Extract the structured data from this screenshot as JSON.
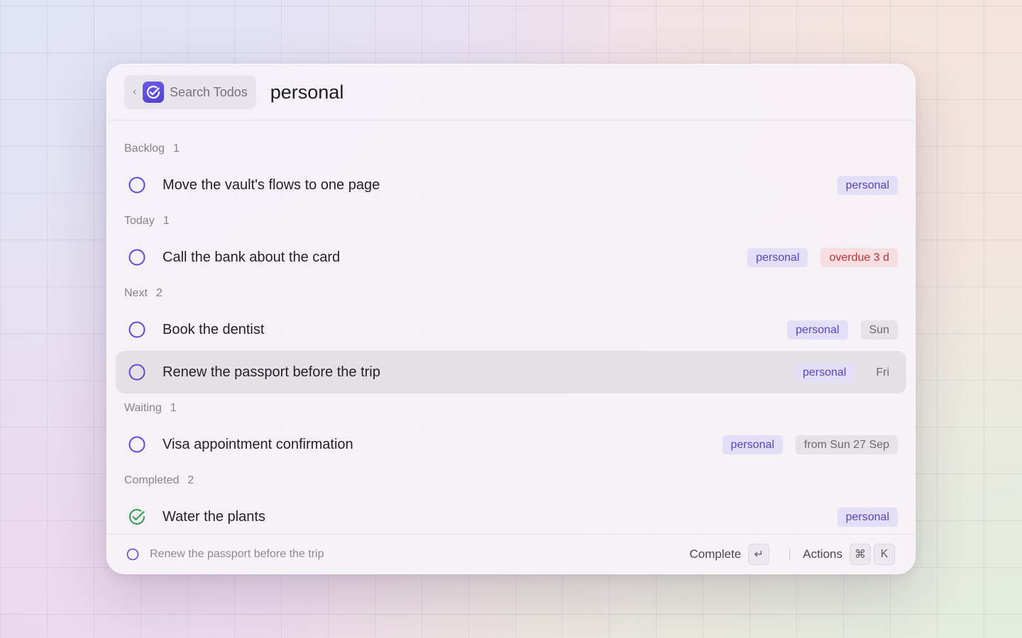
{
  "header": {
    "back_icon": "chevron-left-icon",
    "app_icon": "todo-check-icon",
    "crumb_label": "Search Todos",
    "search_value": "personal"
  },
  "sections": [
    {
      "name": "Backlog",
      "count": "1",
      "items": [
        {
          "title": "Move the vault's flows to one page",
          "done": false,
          "tags": [
            {
              "text": "personal",
              "kind": "label"
            }
          ]
        }
      ]
    },
    {
      "name": "Today",
      "count": "1",
      "items": [
        {
          "title": "Call the bank about the card",
          "done": false,
          "tags": [
            {
              "text": "personal",
              "kind": "label"
            },
            {
              "text": "overdue 3 d",
              "kind": "overdue"
            }
          ]
        }
      ]
    },
    {
      "name": "Next",
      "count": "2",
      "items": [
        {
          "title": "Book the dentist",
          "done": false,
          "tags": [
            {
              "text": "personal",
              "kind": "label"
            },
            {
              "text": "Sun",
              "kind": "date"
            }
          ]
        },
        {
          "title": "Renew the passport before the trip",
          "done": false,
          "selected": true,
          "tags": [
            {
              "text": "personal",
              "kind": "label"
            },
            {
              "text": "Fri",
              "kind": "date"
            }
          ]
        }
      ]
    },
    {
      "name": "Waiting",
      "count": "1",
      "items": [
        {
          "title": "Visa appointment confirmation",
          "done": false,
          "tags": [
            {
              "text": "personal",
              "kind": "label"
            },
            {
              "text": "from Sun 27 Sep",
              "kind": "date"
            }
          ]
        }
      ]
    },
    {
      "name": "Completed",
      "count": "2",
      "items": [
        {
          "title": "Water the plants",
          "done": true,
          "tags": [
            {
              "text": "personal",
              "kind": "label"
            }
          ]
        }
      ]
    }
  ],
  "footer": {
    "selected_title": "Renew the passport before the trip",
    "primary_action": "Complete",
    "primary_key": "↵",
    "secondary_action": "Actions",
    "secondary_keys": [
      "⌘",
      "K"
    ]
  },
  "colors": {
    "accent": "#5b4bd6",
    "done": "#2e9a4e",
    "overdue": "#c1303a"
  }
}
